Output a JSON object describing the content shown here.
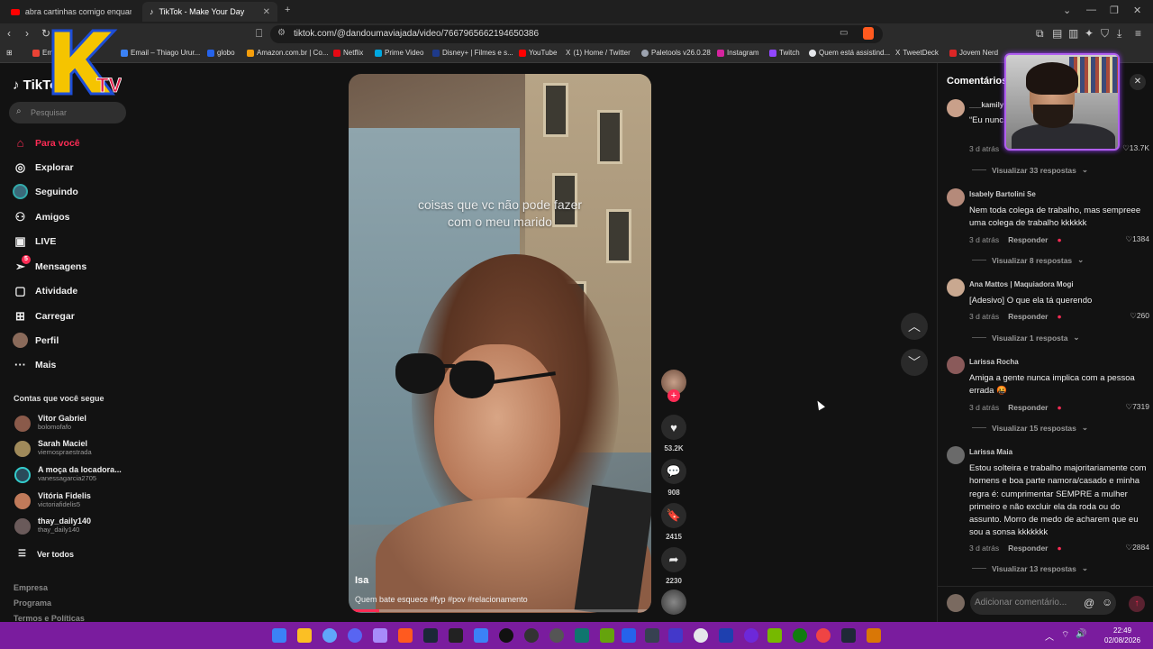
{
  "browser": {
    "tabs": [
      {
        "title": "abra cartinhas comigo enquanto con"
      },
      {
        "title": "TikTok - Make Your Day"
      }
    ],
    "url": "tiktok.com/@dandoumaviajada/video/7667965662194650386",
    "bookmarks": [
      {
        "label": "Em"
      },
      {
        "label": "Email – Thiago Urur..."
      },
      {
        "label": "globo"
      },
      {
        "label": "Amazon.com.br | Co..."
      },
      {
        "label": "Netflix"
      },
      {
        "label": "Prime Video"
      },
      {
        "label": "Disney+ | Filmes e s..."
      },
      {
        "label": "YouTube"
      },
      {
        "label": "(1) Home / Twitter"
      },
      {
        "label": "Paletools v26.0.28"
      },
      {
        "label": "Instagram"
      },
      {
        "label": "Twitch"
      },
      {
        "label": "Quem está assistind..."
      },
      {
        "label": "TweetDeck"
      },
      {
        "label": "Jovem Nerd"
      }
    ]
  },
  "overlay_logo": {
    "text": "K",
    "subtext": "TV"
  },
  "sidebar": {
    "logo": "TikTok",
    "search_placeholder": "Pesquisar",
    "nav": [
      {
        "label": "Para você",
        "icon": "home-icon"
      },
      {
        "label": "Explorar",
        "icon": "compass-icon"
      },
      {
        "label": "Seguindo",
        "icon": "following-avatar-icon"
      },
      {
        "label": "Amigos",
        "icon": "friends-icon"
      },
      {
        "label": "LIVE",
        "icon": "live-icon"
      },
      {
        "label": "Mensagens",
        "icon": "messages-icon",
        "badge": "5"
      },
      {
        "label": "Atividade",
        "icon": "activity-icon"
      },
      {
        "label": "Carregar",
        "icon": "upload-icon"
      },
      {
        "label": "Perfil",
        "icon": "profile-avatar-icon"
      },
      {
        "label": "Mais",
        "icon": "more-icon"
      }
    ],
    "following_title": "Contas que você segue",
    "following": [
      {
        "name": "Vitor Gabriel",
        "handle": "bolomofafo"
      },
      {
        "name": "Sarah Maciel",
        "handle": "viemospraestrada"
      },
      {
        "name": "A moça da locadora...",
        "handle": "vanessagarcia2705"
      },
      {
        "name": "Vitória Fidelis",
        "handle": "victoriafidelis5"
      },
      {
        "name": "thay_daily140",
        "handle": "thay_daily140"
      }
    ],
    "see_all": "Ver todos",
    "footer": [
      "Empresa",
      "Programa",
      "Termos e Políticas"
    ]
  },
  "video": {
    "overlay_text_line1": "coisas que vc não pode fazer",
    "overlay_text_line2": "com o meu marido",
    "author": "Isa",
    "description": "Quem bate esquece #fyp #pov #relacionamento",
    "progress": 0.1
  },
  "actions": {
    "likes": "53.2K",
    "comments": "908",
    "saves": "2415",
    "shares": "2230"
  },
  "comments_panel": {
    "title": "Comentários",
    "reply_label": "Responder",
    "placeholder": "Adicionar comentário...",
    "items": [
      {
        "user": "___kamily",
        "text": "“Eu nunc... guardei e...",
        "time": "3 d atrás",
        "likes": "13.7K",
        "replies": "Visualizar 33 respostas"
      },
      {
        "user": "Isabely Bartolini Se",
        "text": "Nem toda colega de trabalho, mas sempreee uma colega de trabalho kkkkkk",
        "time": "3 d atrás",
        "likes": "1384",
        "replies": "Visualizar 8 respostas"
      },
      {
        "user": "Ana Mattos | Maquiadora Mogi",
        "text": "[Adesivo] O que ela tá querendo",
        "time": "3 d atrás",
        "likes": "260",
        "replies": "Visualizar 1 resposta"
      },
      {
        "user": "Larissa Rocha",
        "text": "Amiga a gente nunca implica com a pessoa errada 🤬",
        "time": "3 d atrás",
        "likes": "7319",
        "replies": "Visualizar 15 respostas"
      },
      {
        "user": "Larissa Maia",
        "text": "Estou solteira e trabalho majoritariamente com homens e boa parte namora/casado e minha regra é: cumprimentar SEMPRE a mulher primeiro e não excluir ela da roda ou do assunto. Morro de medo de acharem que eu sou a sonsa kkkkkkk",
        "time": "3 d atrás",
        "likes": "2884",
        "replies": "Visualizar 13 respostas"
      }
    ]
  },
  "taskbar": {
    "time": "22:49",
    "date": "02/08/2026"
  }
}
